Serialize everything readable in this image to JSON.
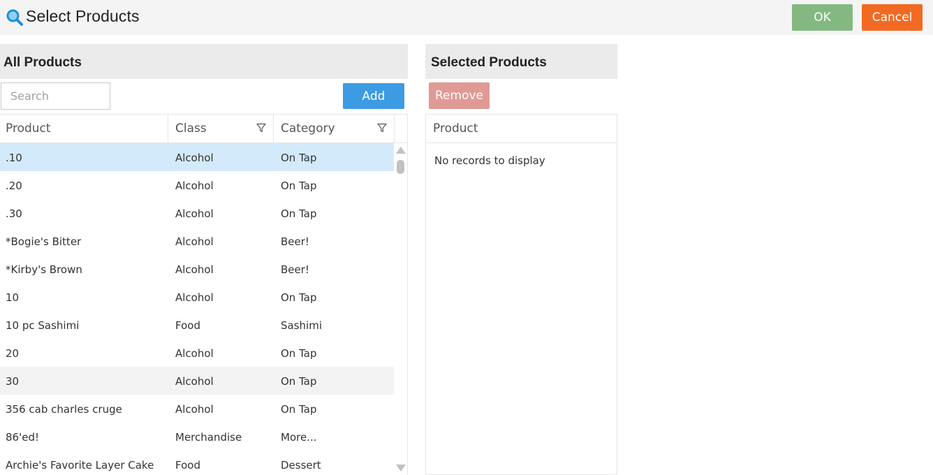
{
  "window": {
    "title": "Select Products",
    "ok_label": "OK",
    "cancel_label": "Cancel"
  },
  "all_products": {
    "header": "All Products",
    "search_placeholder": "Search",
    "add_label": "Add",
    "columns": [
      "Product",
      "Class",
      "Category"
    ],
    "rows": [
      {
        "product": ".10",
        "class": "Alcohol",
        "category": "On Tap",
        "state": "selected"
      },
      {
        "product": ".20",
        "class": "Alcohol",
        "category": "On Tap",
        "state": ""
      },
      {
        "product": ".30",
        "class": "Alcohol",
        "category": "On Tap",
        "state": ""
      },
      {
        "product": "*Bogie's Bitter",
        "class": "Alcohol",
        "category": "Beer!",
        "state": ""
      },
      {
        "product": "*Kirby's Brown",
        "class": "Alcohol",
        "category": "Beer!",
        "state": ""
      },
      {
        "product": "10",
        "class": "Alcohol",
        "category": "On Tap",
        "state": ""
      },
      {
        "product": "10 pc Sashimi",
        "class": "Food",
        "category": "Sashimi",
        "state": ""
      },
      {
        "product": "20",
        "class": "Alcohol",
        "category": "On Tap",
        "state": ""
      },
      {
        "product": "30",
        "class": "Alcohol",
        "category": "On Tap",
        "state": "hover"
      },
      {
        "product": "356 cab charles cruge",
        "class": "Alcohol",
        "category": "On Tap",
        "state": ""
      },
      {
        "product": "86'ed!",
        "class": "Merchandise",
        "category": "More...",
        "state": ""
      },
      {
        "product": "Archie's Favorite Layer Cake",
        "class": "Food",
        "category": "Dessert",
        "state": ""
      }
    ]
  },
  "selected_products": {
    "header": "Selected Products",
    "remove_label": "Remove",
    "column": "Product",
    "empty_message": "No records to display"
  },
  "colors": {
    "ok": "#83b981",
    "cancel": "#f26a22",
    "add": "#3d9be3",
    "remove": "#e09a96",
    "selected_row": "#d3eafb"
  }
}
